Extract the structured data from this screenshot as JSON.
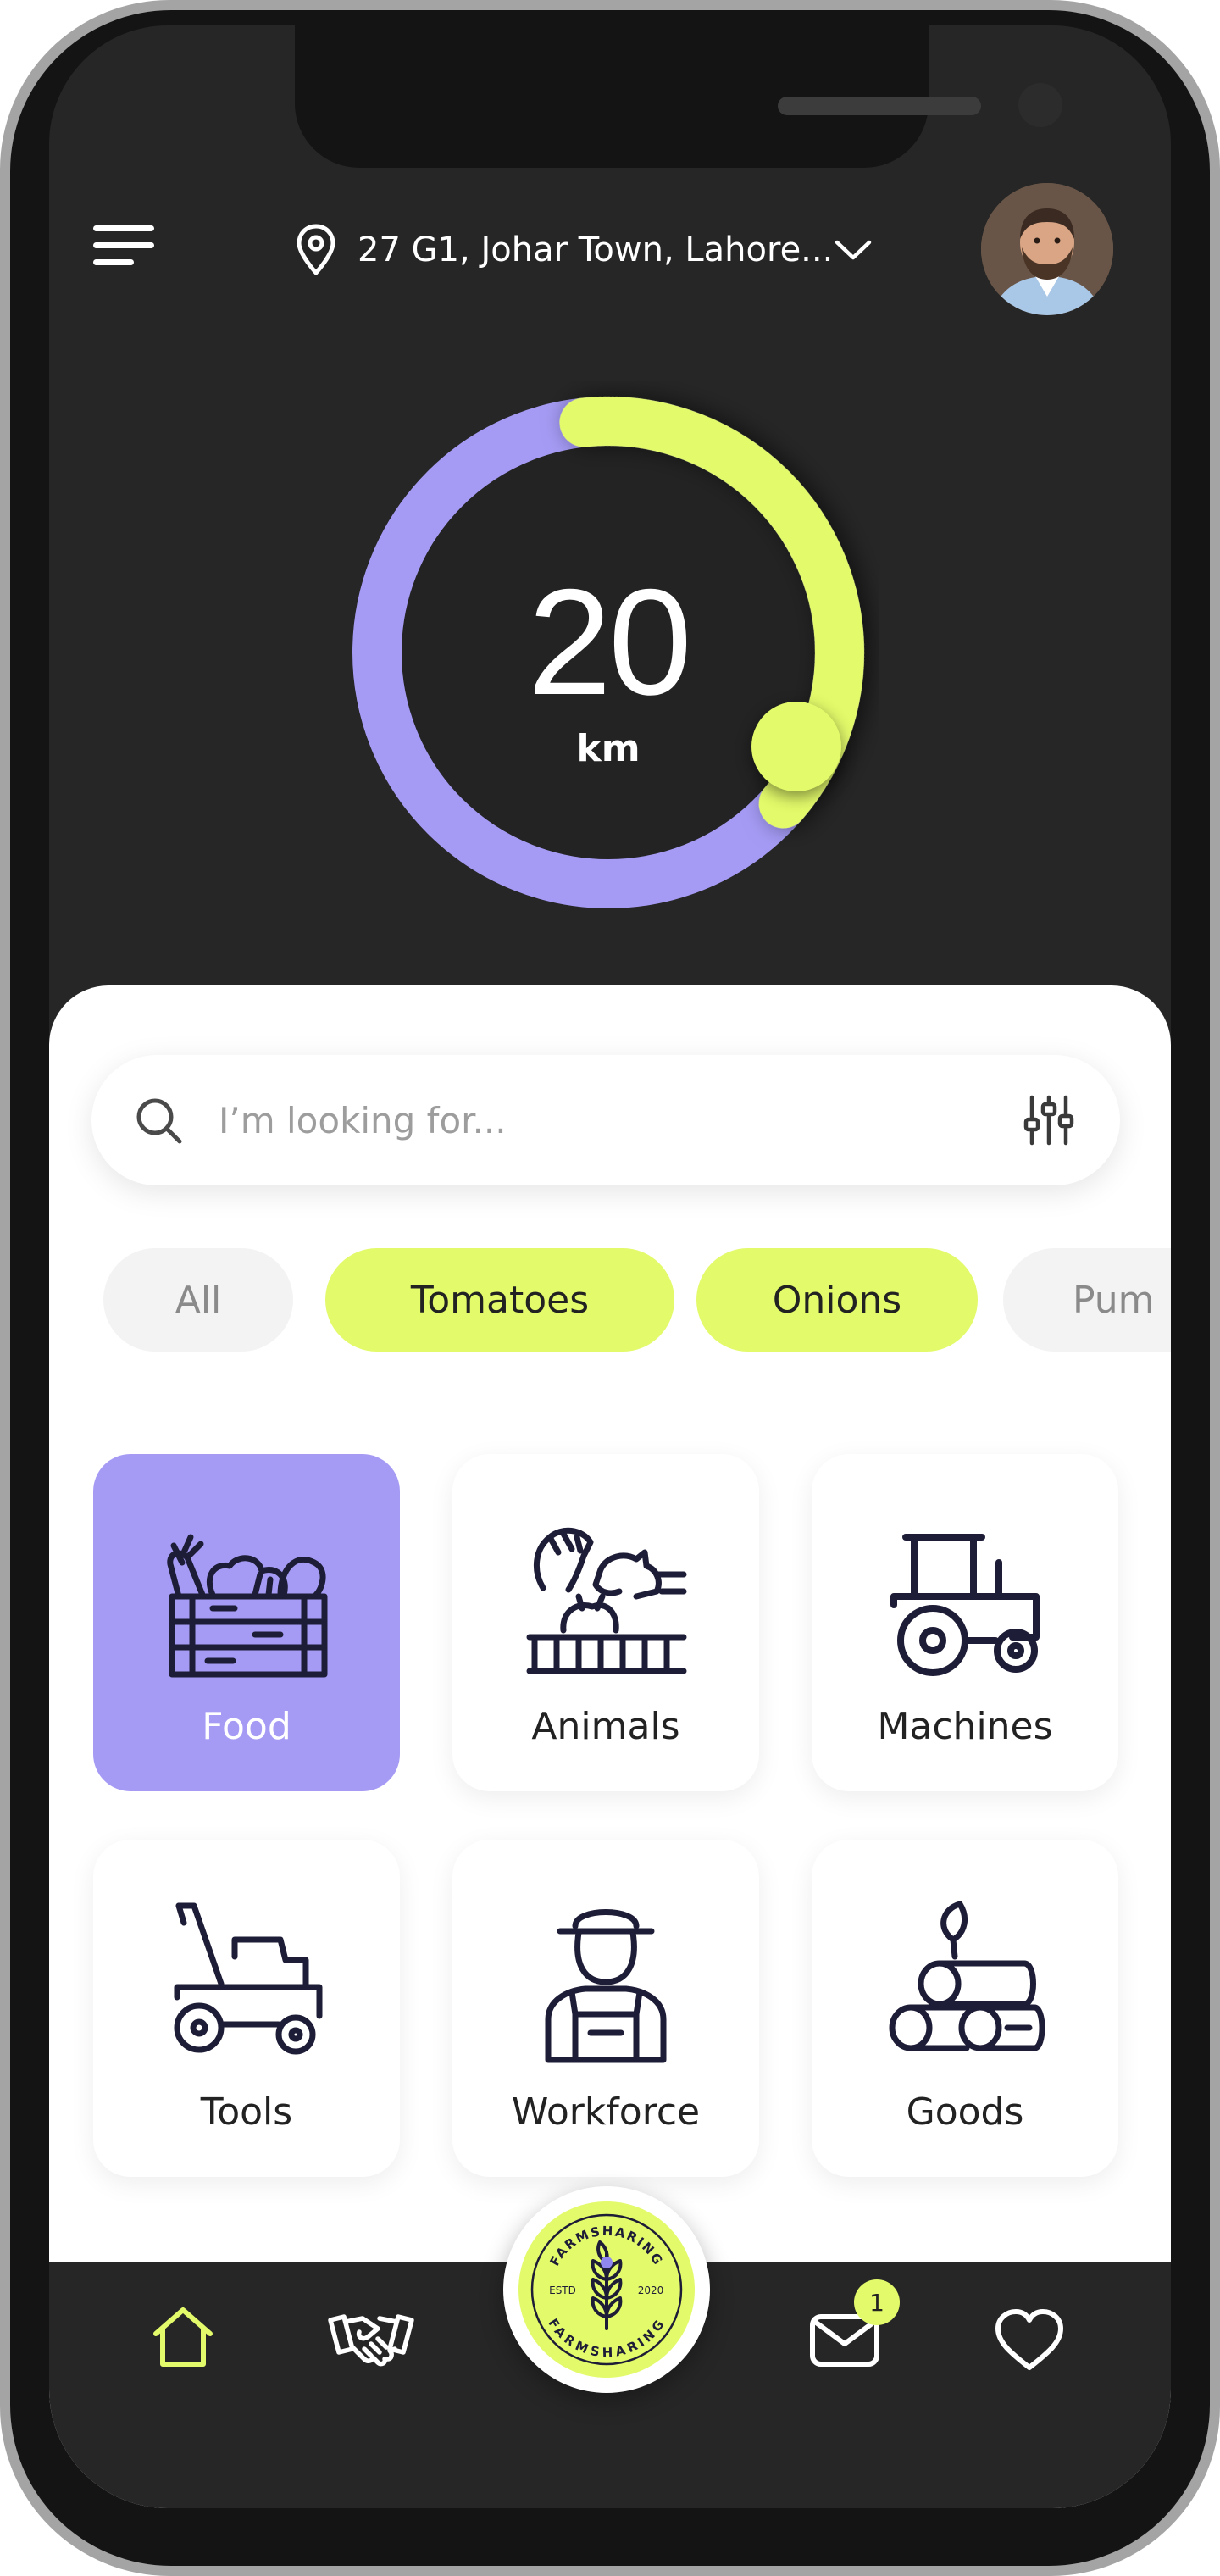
{
  "header": {
    "location": "27 G1, Johar Town, Lahore...",
    "icons": {
      "menu": "hamburger-menu-icon",
      "location": "map-pin-icon",
      "dropdown": "chevron-down-icon",
      "avatar": "user-avatar"
    }
  },
  "distance": {
    "value": "20",
    "unit": "km",
    "fraction": 0.38,
    "track_color": "#a59bf5",
    "progress_color": "#e3fa6a"
  },
  "search": {
    "placeholder": "I’m looking for..."
  },
  "chips": [
    {
      "label": "All",
      "active": false
    },
    {
      "label": "Tomatoes",
      "active": true
    },
    {
      "label": "Onions",
      "active": true
    },
    {
      "label": "Pum",
      "active": false
    }
  ],
  "categories": [
    {
      "label": "Food",
      "icon": "vegetable-crate-icon",
      "selected": true
    },
    {
      "label": "Animals",
      "icon": "farm-animals-icon",
      "selected": false
    },
    {
      "label": "Machines",
      "icon": "tractor-icon",
      "selected": false
    },
    {
      "label": "Tools",
      "icon": "lawn-mower-icon",
      "selected": false
    },
    {
      "label": "Workforce",
      "icon": "farmer-icon",
      "selected": false
    },
    {
      "label": "Goods",
      "icon": "firewood-logs-icon",
      "selected": false
    }
  ],
  "tabbar": {
    "items": [
      {
        "name": "home",
        "icon": "home-icon",
        "active": true
      },
      {
        "name": "deals",
        "icon": "handshake-icon",
        "active": false
      },
      {
        "name": "messages",
        "icon": "mail-icon",
        "active": false
      },
      {
        "name": "favorites",
        "icon": "heart-icon",
        "active": false
      }
    ],
    "messages_badge": "1",
    "logo": {
      "top_text": "FARMSHARING",
      "bottom_text": "FARMSHARING",
      "left_text": "ESTD",
      "right_text": "2020"
    }
  },
  "colors": {
    "accent_lime": "#e3fa6a",
    "accent_purple": "#a59bf5",
    "dark_background": "#262626"
  }
}
